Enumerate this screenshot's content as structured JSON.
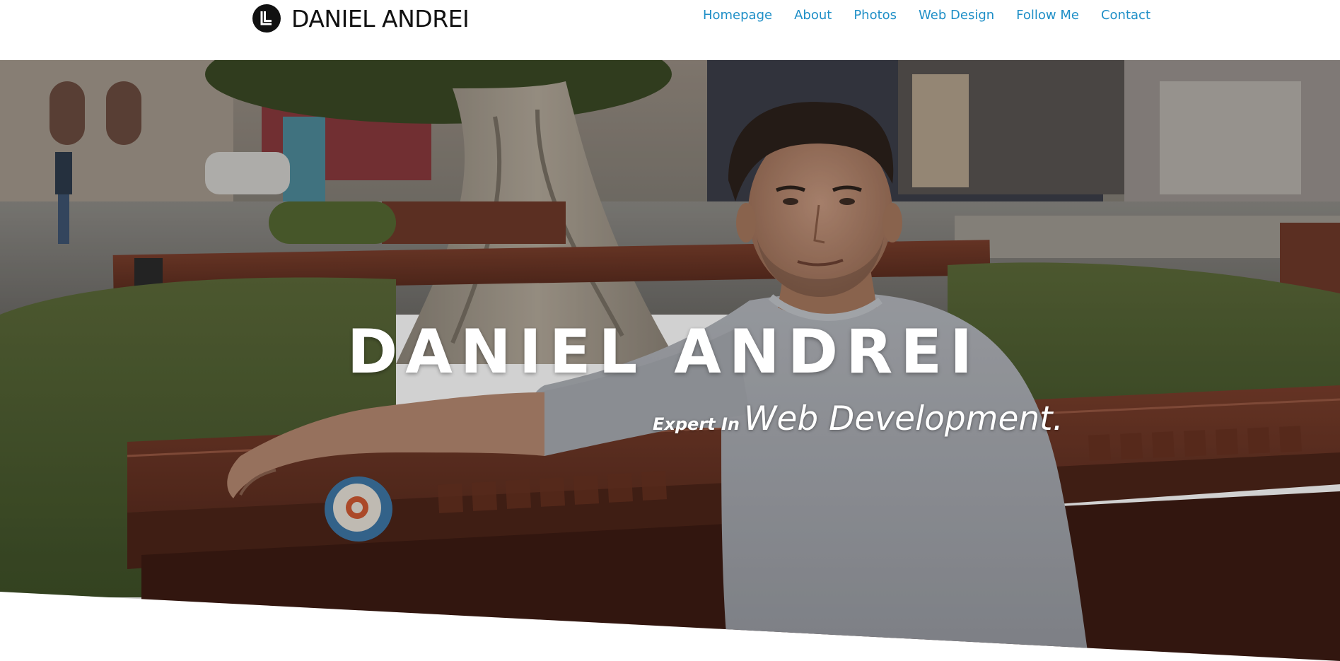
{
  "header": {
    "logo_text": "DANIEL ANDREI",
    "nav": [
      "Homepage",
      "About",
      "Photos",
      "Web Design",
      "Follow Me",
      "Contact"
    ]
  },
  "hero": {
    "title": "DANIEL ANDREI",
    "subtitle_prefix": "Expert In",
    "subtitle_main": "Web Development."
  },
  "colors": {
    "nav_link": "#1f8fc7",
    "logo": "#111111",
    "hero_text": "#ffffff"
  }
}
